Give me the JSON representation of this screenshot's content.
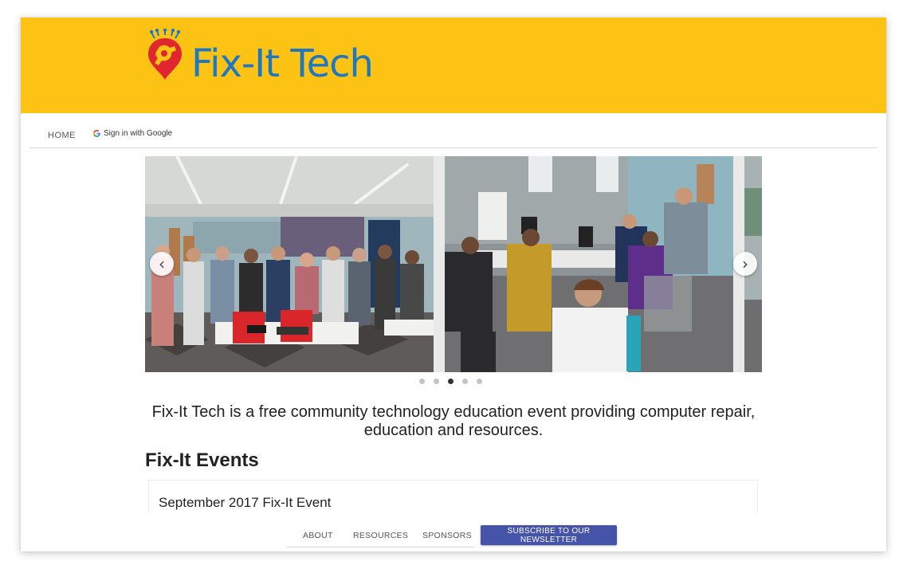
{
  "brand": {
    "name": "Fix-It Tech",
    "text_color": "#1f77c0",
    "mark_color": "#e0262e",
    "header_color": "#fcc314"
  },
  "nav": {
    "home": "HOME",
    "google_signin": "Sign in with Google"
  },
  "carousel": {
    "prev_icon": "chevron-left-icon",
    "next_icon": "chevron-right-icon",
    "prev_glyph": "‹",
    "next_glyph": "›",
    "dot_count": 5,
    "active_dot": 3,
    "slides": [
      {
        "scene": "group-photo"
      },
      {
        "scene": "classroom-photo"
      },
      {
        "scene": "partial-photo"
      }
    ]
  },
  "intro": "Fix-It Tech is a free community technology education event providing computer repair, education and resources.",
  "events": {
    "title": "Fix-It Events",
    "items": [
      {
        "title": "September 2017 Fix-It Event"
      }
    ]
  },
  "footer_nav": {
    "about": "ABOUT",
    "resources": "RESOURCES",
    "sponsors": "SPONSORS",
    "subscribe": "SUBSCRIBE TO OUR NEWSLETTER",
    "subscribe_color": "#4553a8"
  }
}
